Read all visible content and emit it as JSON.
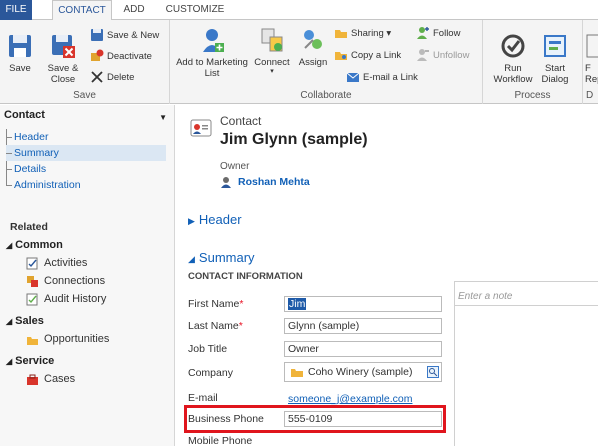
{
  "ribbon_tabs": [
    "FILE",
    "CONTACT",
    "ADD",
    "CUSTOMIZE"
  ],
  "ribbon": {
    "save_group": {
      "label": "Save",
      "save": "Save",
      "save_close_line1": "Save &",
      "save_close_line2": "Close",
      "save_new": "Save & New",
      "deactivate": "Deactivate",
      "delete": "Delete"
    },
    "collaborate_group": {
      "label": "Collaborate",
      "add_to_marketing_line1": "Add to Marketing",
      "add_to_marketing_line2": "List",
      "connect": "Connect",
      "assign": "Assign",
      "sharing": "Sharing",
      "copy_link": "Copy a Link",
      "email_link": "E-mail a Link",
      "follow": "Follow",
      "unfollow": "Unfollow"
    },
    "process_group": {
      "label": "Process",
      "run_workflow_line1": "Run",
      "run_workflow_line2": "Workflow",
      "start_dialog_line1": "Start",
      "start_dialog_line2": "Dialog"
    },
    "partial_group": {
      "label": "D",
      "button_line1": "F",
      "button_line2": "Rep"
    }
  },
  "nav": {
    "selector": "Contact",
    "items": [
      "Header",
      "Summary",
      "Details",
      "Administration"
    ],
    "selected_index": 1,
    "related_label": "Related",
    "groups": [
      {
        "name": "Common",
        "items": [
          "Activities",
          "Connections",
          "Audit History"
        ]
      },
      {
        "name": "Sales",
        "items": [
          "Opportunities"
        ]
      },
      {
        "name": "Service",
        "items": [
          "Cases"
        ]
      }
    ]
  },
  "record": {
    "entity": "Contact",
    "title": "Jim Glynn (sample)",
    "owner_label": "Owner",
    "owner_value": "Roshan Mehta"
  },
  "sections": {
    "header": "Header",
    "summary": "Summary",
    "contact_info": "CONTACT INFORMATION"
  },
  "fields": {
    "first_name": {
      "label": "First Name",
      "required": "*",
      "value": "Jim"
    },
    "last_name": {
      "label": "Last Name",
      "required": "*",
      "value": "Glynn (sample)"
    },
    "job_title": {
      "label": "Job Title",
      "value": "Owner"
    },
    "company": {
      "label": "Company",
      "value": "Coho Winery (sample)"
    },
    "email": {
      "label": "E-mail",
      "value": "someone_j@example.com"
    },
    "business_phone": {
      "label": "Business Phone",
      "value": "555-0109"
    },
    "mobile_phone": {
      "label": "Mobile Phone",
      "value": ""
    }
  },
  "notes": {
    "placeholder": "Enter a note"
  },
  "colors": {
    "brand_blue": "#2b579a",
    "link_blue": "#1160b7",
    "required_red": "#e81123",
    "highlight_red": "#e0151d"
  }
}
